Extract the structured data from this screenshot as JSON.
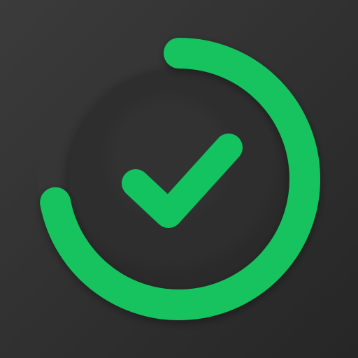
{
  "icon": {
    "name": "progress-checkmark-icon",
    "progress_fraction": 0.72,
    "colors": {
      "background_top": "#3b3b3b",
      "background_bottom": "#262626",
      "track": "#363636",
      "inner_disc": "#2f2f2f",
      "accent": "#12c35f"
    }
  }
}
